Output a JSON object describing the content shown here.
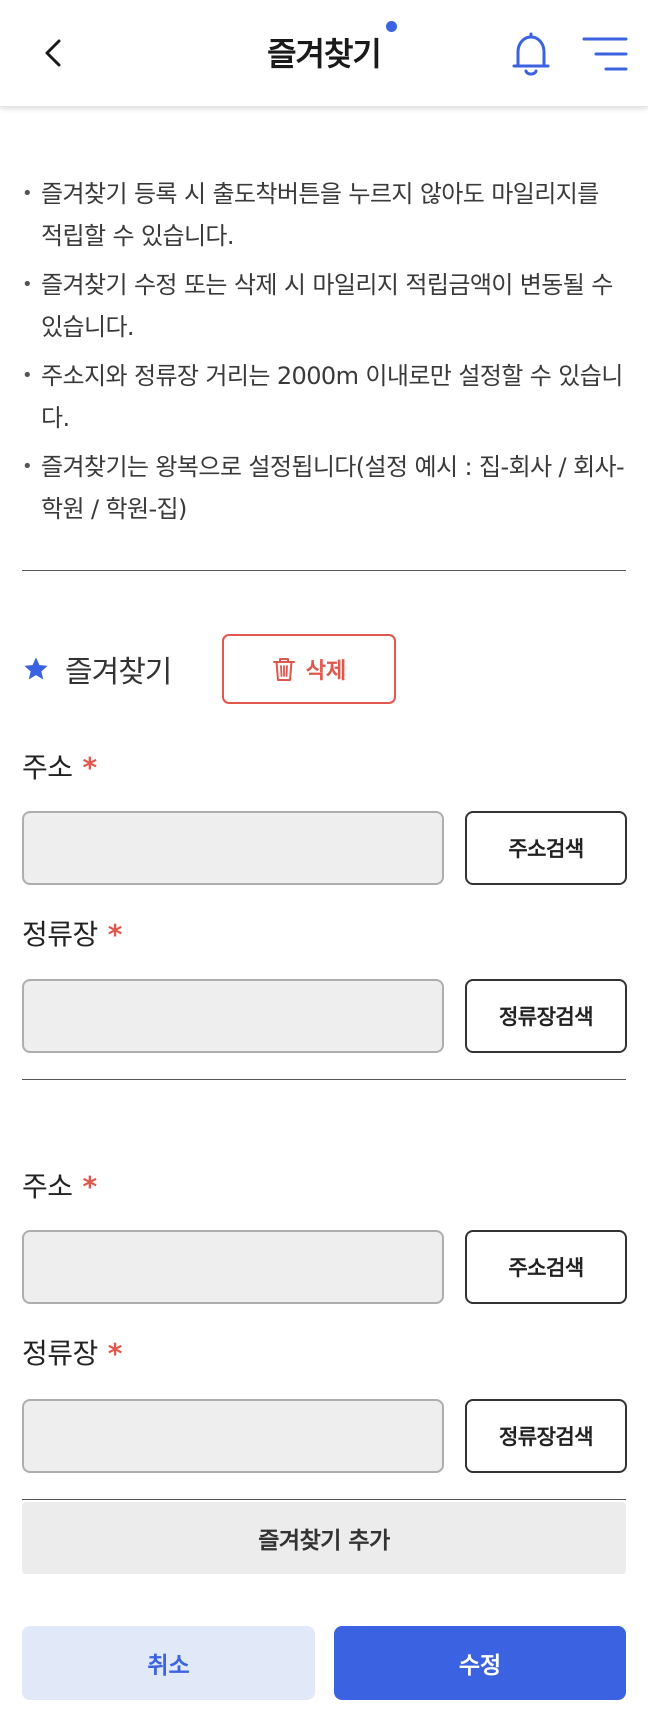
{
  "header": {
    "title": "즐겨찾기",
    "back_icon": "chevron-left-icon",
    "bell_icon": "bell-icon",
    "menu_icon": "menu-icon"
  },
  "notices": [
    "즐겨찾기 등록 시 출도착버튼을 누르지 않아도 마일리지를 적립할 수 있습니다.",
    "즐겨찾기 수정 또는 삭제 시 마일리지 적립금액이 변동될 수 있습니다.",
    "주소지와 정류장 거리는 2000m 이내로만 설정할 수 있습니다.",
    "즐겨찾기는 왕복으로 설정됩니다(설정 예시 : 집-회사 / 회사-학원 / 학원-집)"
  ],
  "favorite": {
    "heading": "즐겨찾기",
    "delete_label": "삭제"
  },
  "forms": [
    {
      "address_label": "주소",
      "address_value": "",
      "address_search": "주소검색",
      "stop_label": "정류장",
      "stop_value": "",
      "stop_search": "정류장검색"
    },
    {
      "address_label": "주소",
      "address_value": "",
      "address_search": "주소검색",
      "stop_label": "정류장",
      "stop_value": "",
      "stop_search": "정류장검색"
    }
  ],
  "required_mark": "*",
  "add_favorite_label": "즐겨찾기 추가",
  "actions": {
    "cancel": "취소",
    "save": "수정"
  },
  "colors": {
    "primary": "#3b62e0",
    "primary_light": "#e1e9f9",
    "danger": "#e2574c",
    "input_bg": "#eeeeee"
  }
}
